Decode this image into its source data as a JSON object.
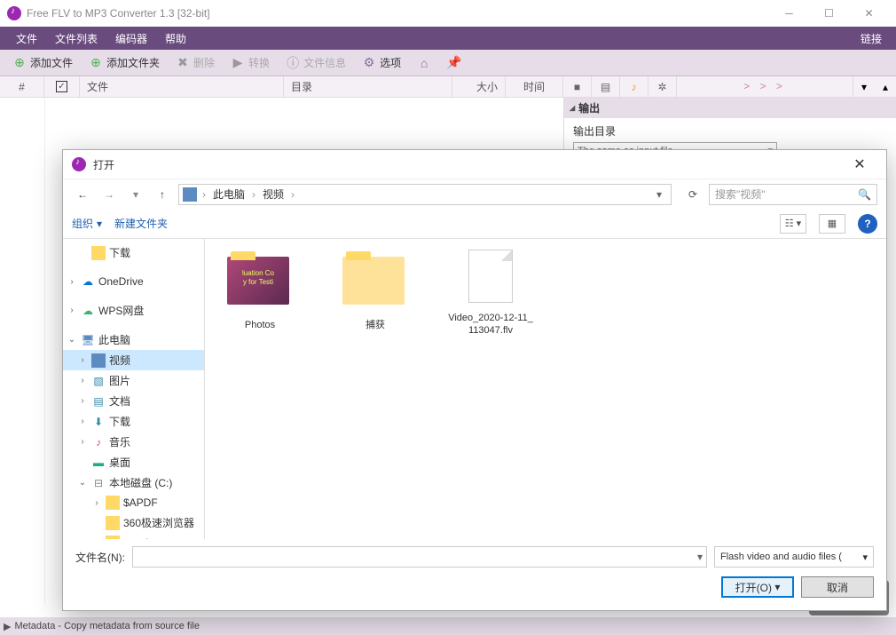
{
  "window": {
    "title": "Free FLV to MP3 Converter 1.3  [32-bit]"
  },
  "menu": {
    "file": "文件",
    "filelist": "文件列表",
    "encoder": "编码器",
    "help": "帮助",
    "link": "链接"
  },
  "toolbar": {
    "add_file": "添加文件",
    "add_folder": "添加文件夹",
    "delete": "删除",
    "convert": "转换",
    "file_info": "文件信息",
    "options": "选项"
  },
  "columns": {
    "num": "#",
    "file": "文件",
    "dir": "目录",
    "size": "大小",
    "time": "时间"
  },
  "side": {
    "more": "> > >",
    "output_header": "输出",
    "output_dir_label": "输出目录",
    "output_dir_value": "The same as input file"
  },
  "status": {
    "text": "Metadata - Copy metadata from source file"
  },
  "dialog": {
    "title": "打开",
    "breadcrumb": {
      "pc": "此电脑",
      "videos": "视频"
    },
    "search_placeholder": "搜索\"视频\"",
    "organize": "组织",
    "new_folder": "新建文件夹",
    "tree": {
      "downloads": "下载",
      "onedrive": "OneDrive",
      "wps": "WPS网盘",
      "this_pc": "此电脑",
      "videos": "视频",
      "pictures": "图片",
      "documents": "文档",
      "downloads2": "下载",
      "music": "音乐",
      "desktop": "桌面",
      "local_c": "本地磁盘 (C:)",
      "apdf": "$APDF",
      "browser360": "360极速浏览器",
      "cnwdata": "cnwdata"
    },
    "items": {
      "photos": "Photos",
      "photos_overlay1": "luation Co",
      "photos_overlay2": "y for Testi",
      "capture": "捕获",
      "video_file": "Video_2020-12-11_113047.flv"
    },
    "filename_label": "文件名(N):",
    "filetype": "Flash video and audio files (",
    "open_btn": "打开(O)",
    "cancel_btn": "取消"
  }
}
